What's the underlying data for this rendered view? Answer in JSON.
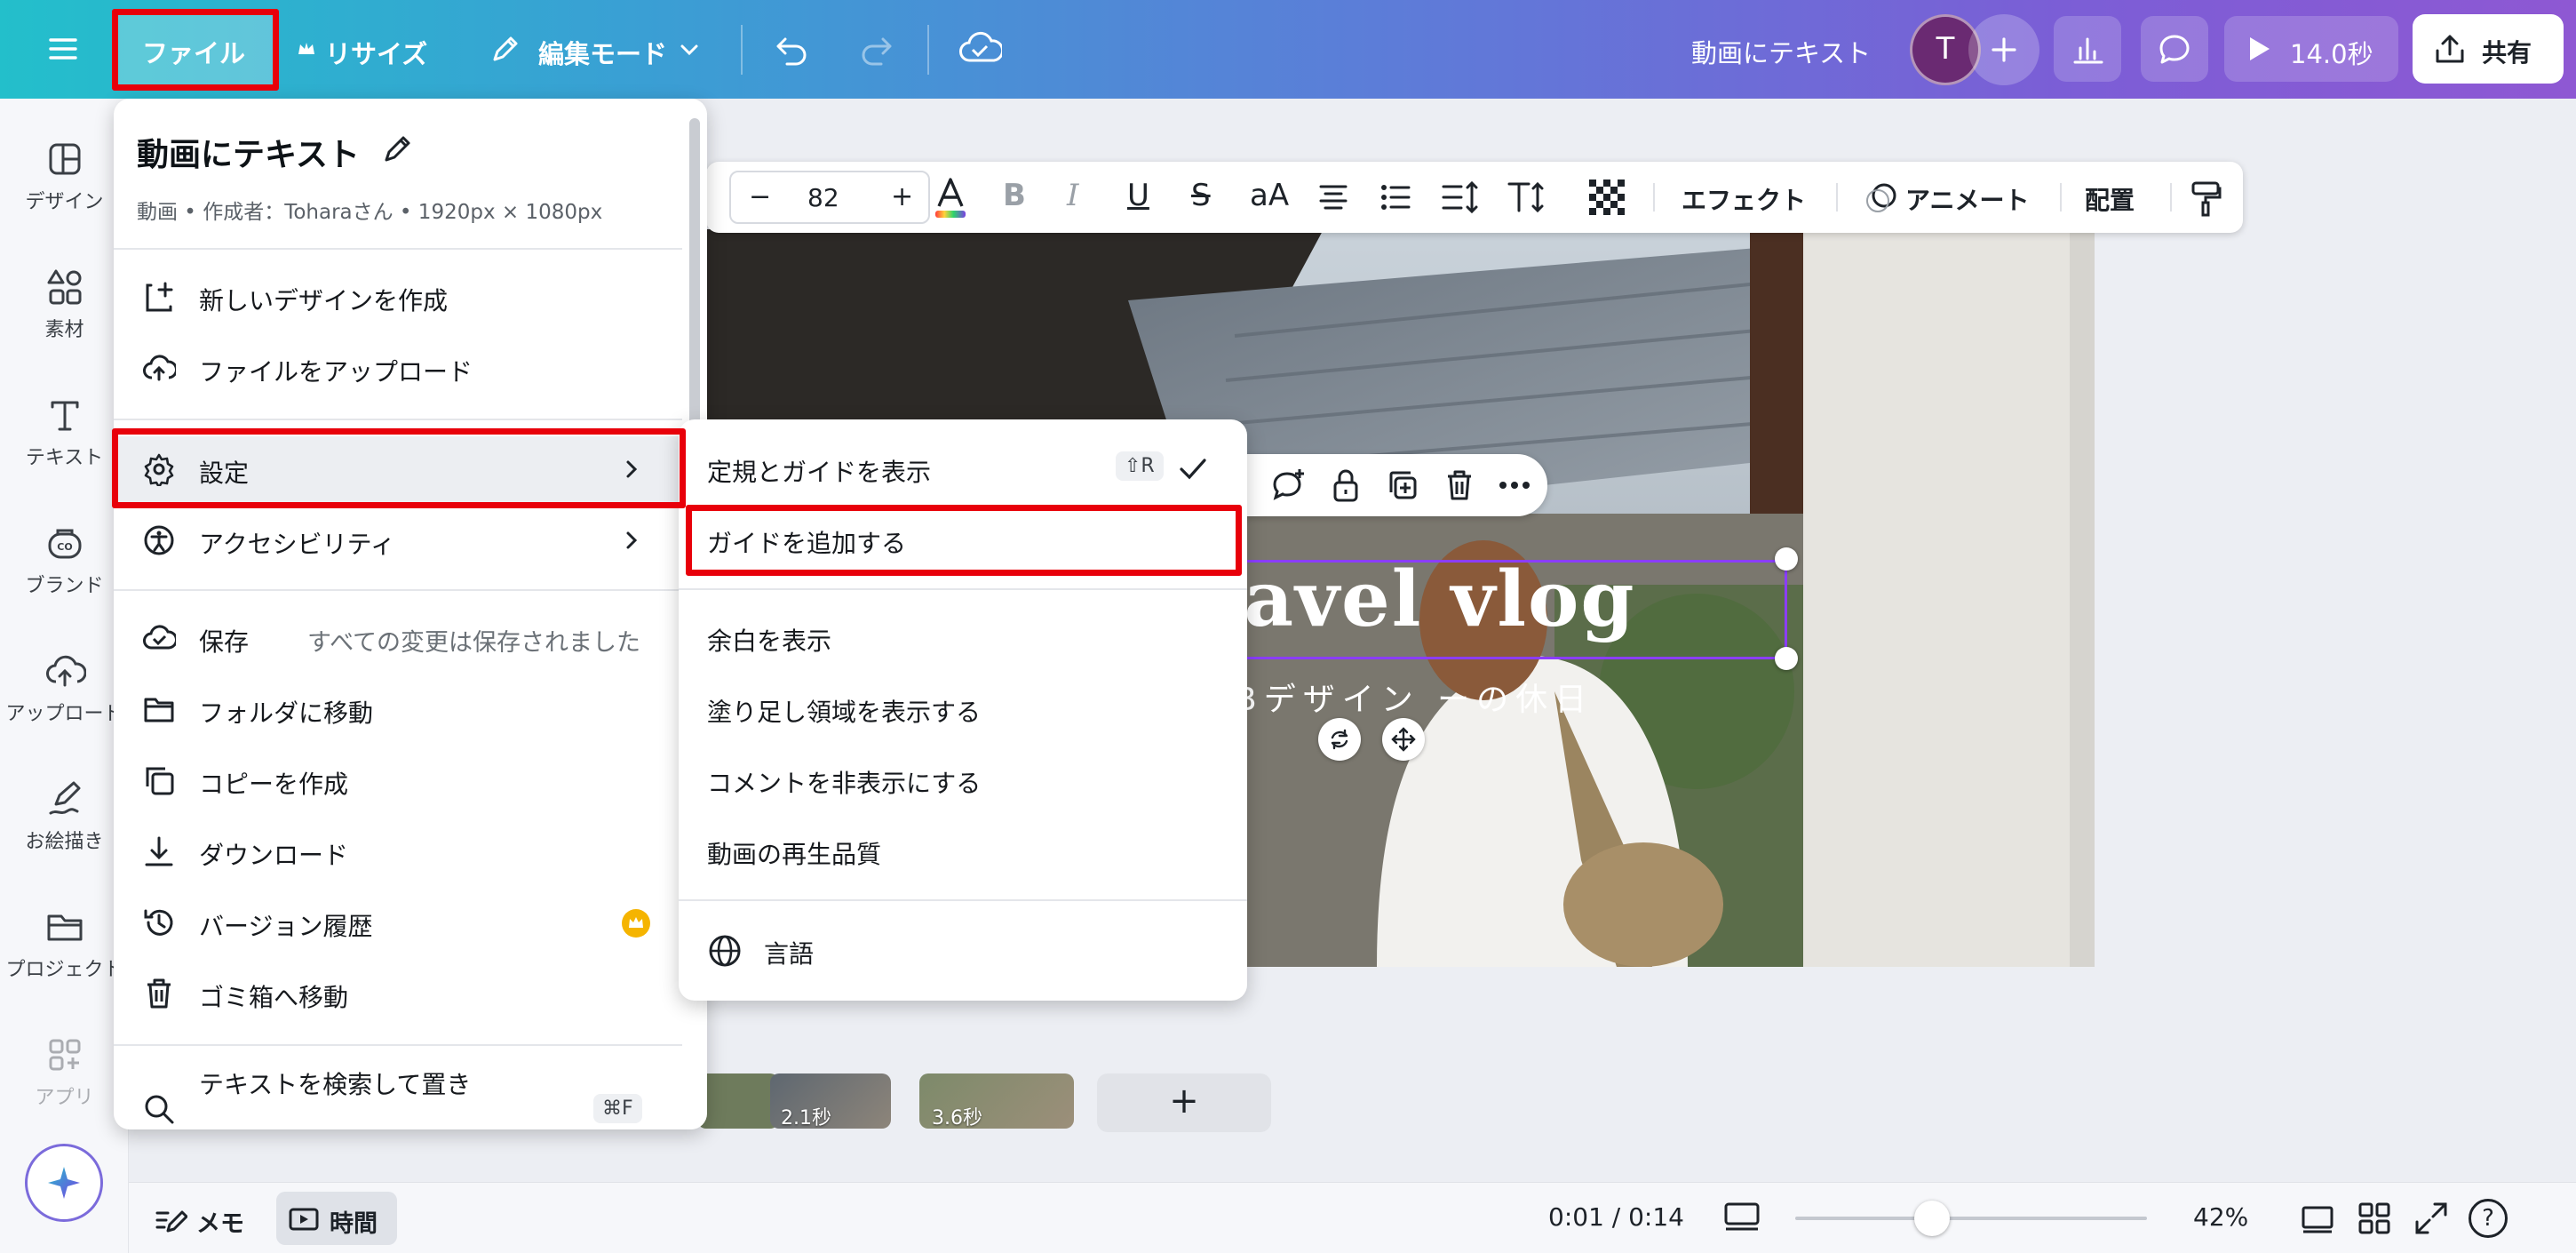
{
  "topbar": {
    "file_label": "ファイル",
    "resize_label": "リサイズ",
    "edit_mode_label": "編集モード",
    "doc_title": "動画にテキスト",
    "avatar_initial": "T",
    "play_label": "14.0秒",
    "share_label": "共有"
  },
  "rail": {
    "items": [
      {
        "label": "デザイン"
      },
      {
        "label": "素材"
      },
      {
        "label": "テキスト"
      },
      {
        "label": "ブランド"
      },
      {
        "label": "アップロード"
      },
      {
        "label": "お絵描き"
      },
      {
        "label": "プロジェクト"
      },
      {
        "label": "アプリ"
      }
    ]
  },
  "text_toolbar": {
    "minus": "−",
    "font_size": "82",
    "plus": "+",
    "bold": "B",
    "italic": "I",
    "underline": "U",
    "strike": "S",
    "case": "aA",
    "effects_label": "エフェクト",
    "animate_label": "アニメート",
    "position_label": "配置"
  },
  "canvas": {
    "heading": "o travel vlog",
    "subheading": "Bデザイン ーの休日"
  },
  "file_menu": {
    "title": "動画にテキスト",
    "meta": "動画 • 作成者：Toharaさん • 1920px × 1080px",
    "items": [
      {
        "label": "新しいデザインを作成"
      },
      {
        "label": "ファイルをアップロード"
      },
      {
        "label": "設定"
      },
      {
        "label": "アクセシビリティ"
      },
      {
        "label": "保存",
        "status": "すべての変更は保存されました"
      },
      {
        "label": "フォルダに移動"
      },
      {
        "label": "コピーを作成"
      },
      {
        "label": "ダウンロード"
      },
      {
        "label": "バージョン履歴"
      },
      {
        "label": "ゴミ箱へ移動"
      },
      {
        "label": "テキストを検索して置き",
        "shortcut": "⌘F"
      }
    ]
  },
  "submenu": {
    "items": [
      {
        "label": "定規とガイドを表示",
        "shortcut": "⇧R"
      },
      {
        "label": "ガイドを追加する"
      },
      {
        "label": "余白を表示"
      },
      {
        "label": "塗り足し領域を表示する"
      },
      {
        "label": "コメントを非表示にする"
      },
      {
        "label": "動画の再生品質"
      },
      {
        "label": "言語"
      }
    ]
  },
  "timeline": {
    "clips": [
      {
        "duration": "2.1秒"
      },
      {
        "duration": "3.6秒"
      }
    ],
    "add_label": "+"
  },
  "bottombar": {
    "notes_label": "メモ",
    "time_label": "時間",
    "timecode": "0:01 / 0:14",
    "zoom": "42%",
    "zoom_level": 0.39,
    "help": "?"
  }
}
